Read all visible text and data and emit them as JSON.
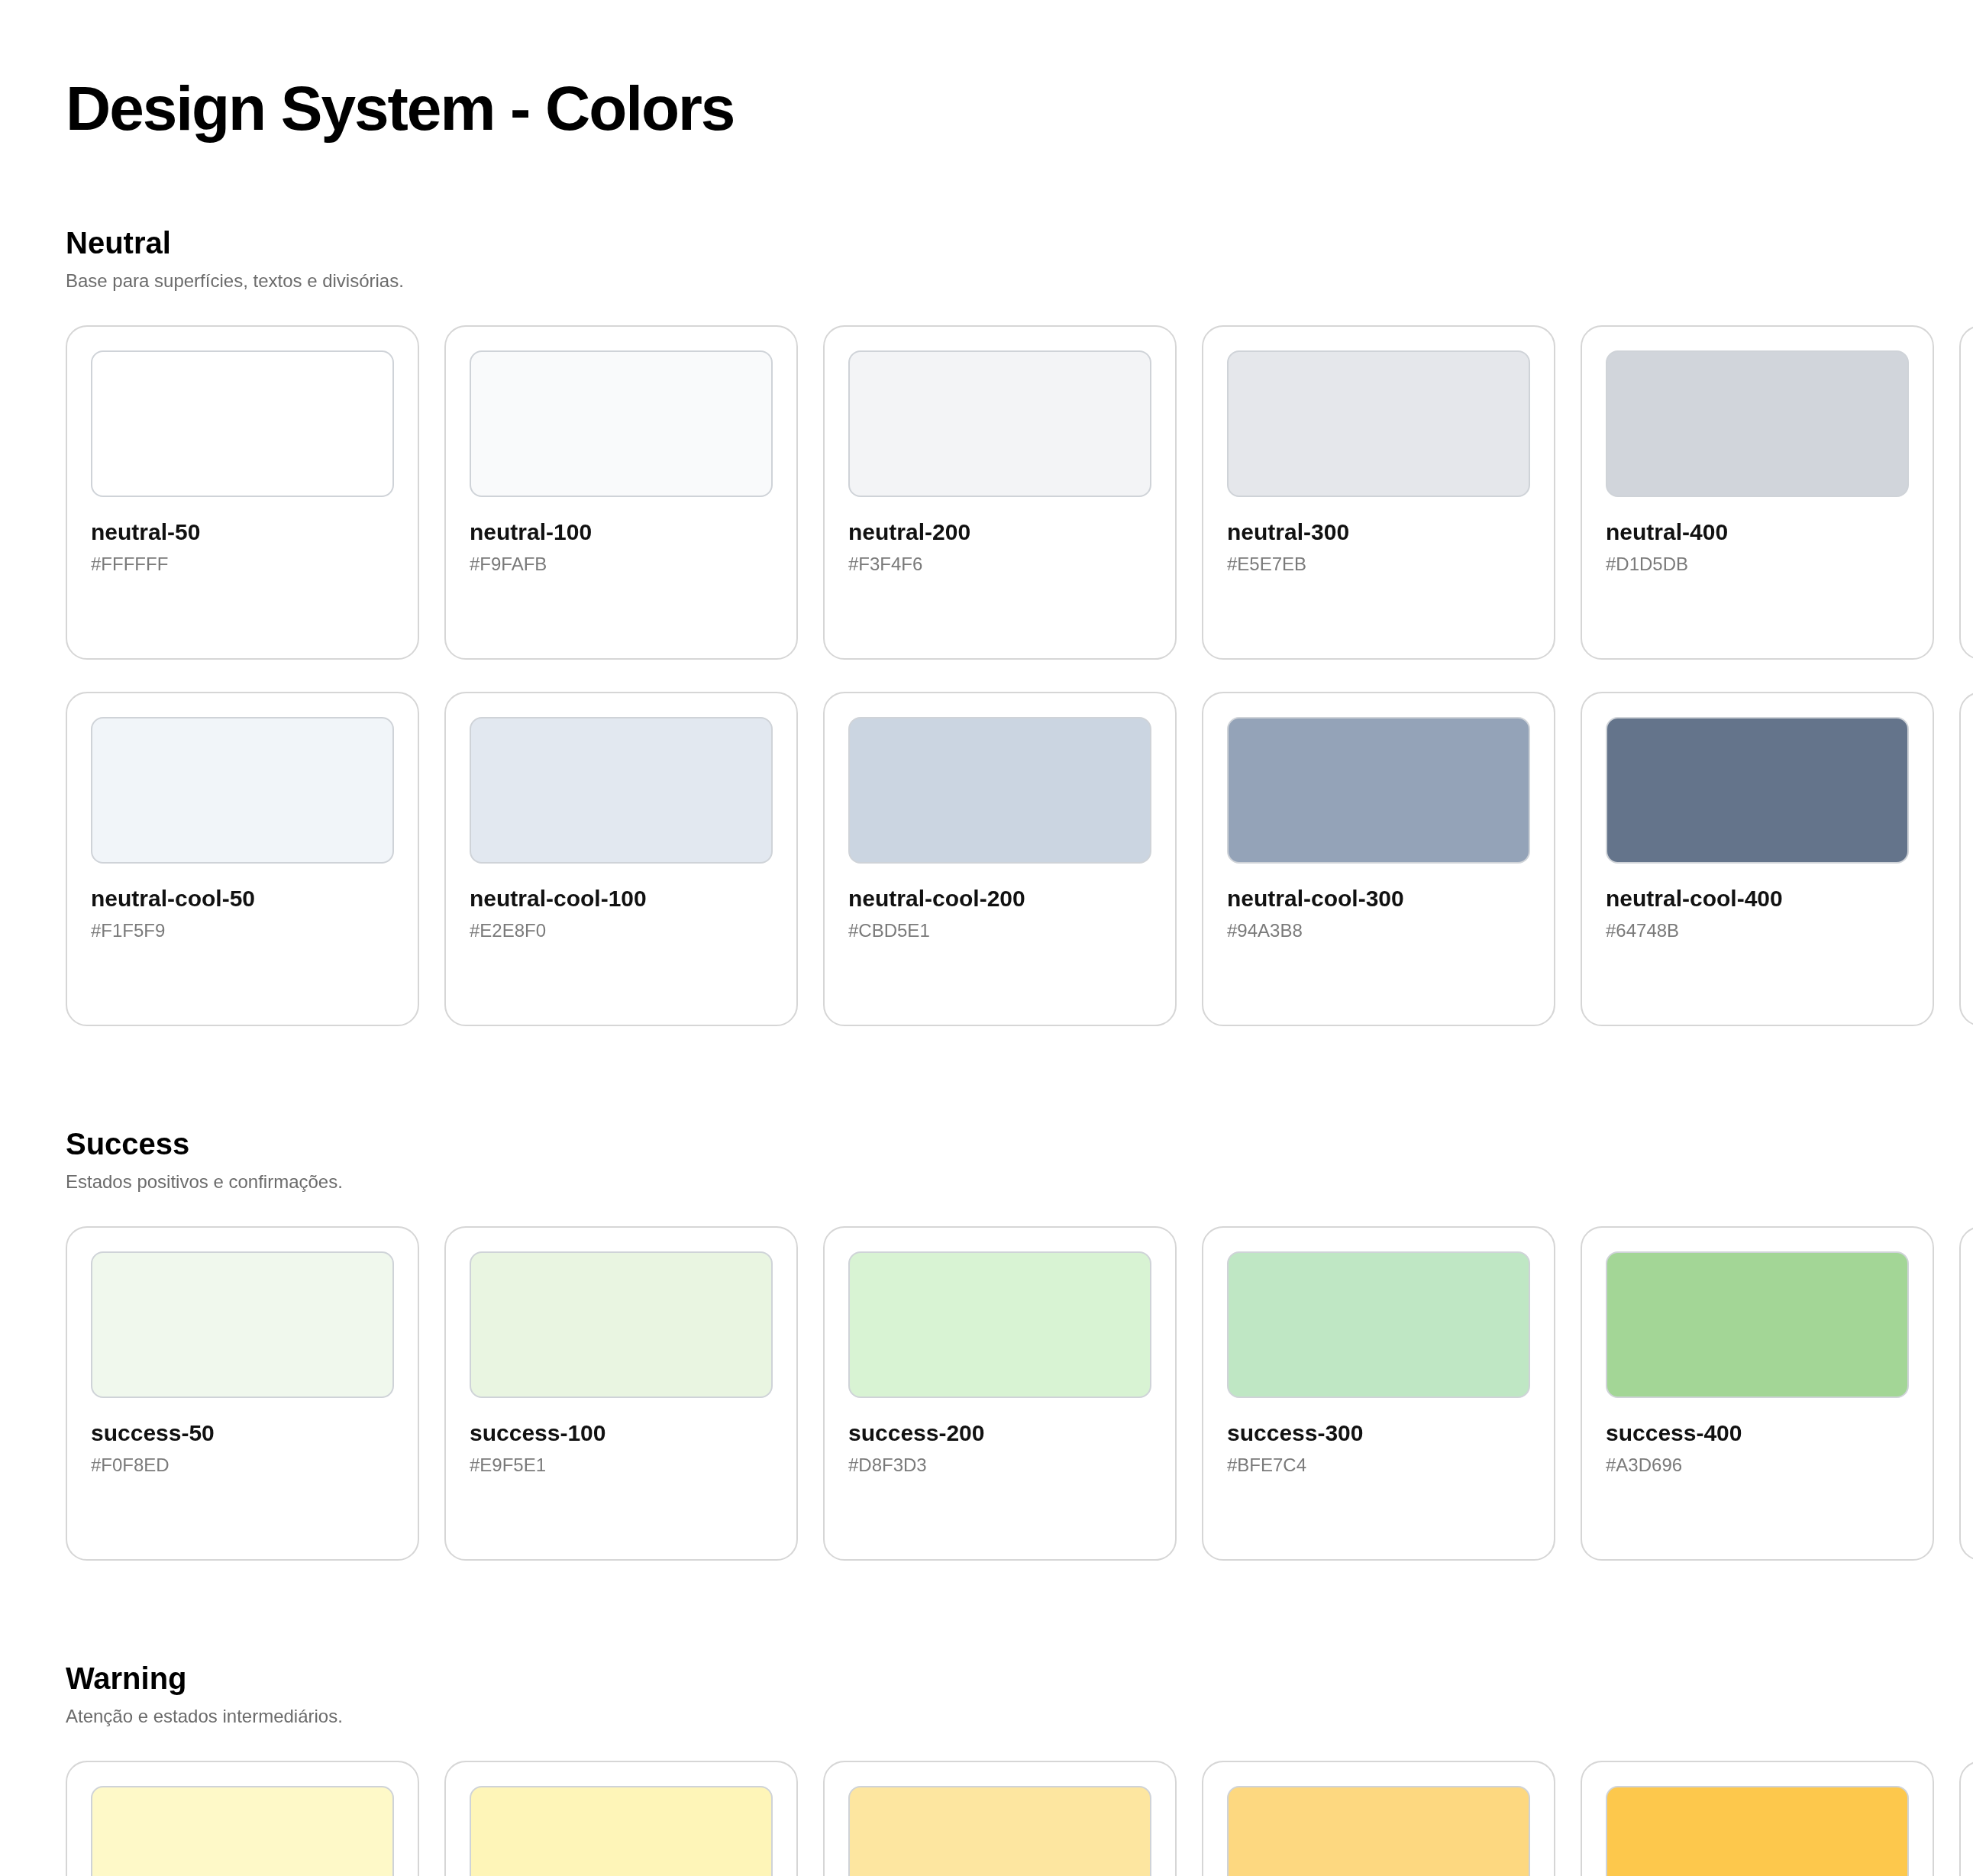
{
  "title": "Design System - Colors",
  "sections": [
    {
      "heading": "Neutral",
      "description": "Base para superfícies, textos e divisórias.",
      "rows": [
        {
          "cut_off_card": true,
          "swatches": [
            {
              "name": "neutral-50",
              "hex": "#FFFFFF",
              "color": "#ffffff"
            },
            {
              "name": "neutral-100",
              "hex": "#F9FAFB",
              "color": "#f9fafb"
            },
            {
              "name": "neutral-200",
              "hex": "#F3F4F6",
              "color": "#f3f4f6"
            },
            {
              "name": "neutral-300",
              "hex": "#E5E7EB",
              "color": "#e5e7eb"
            },
            {
              "name": "neutral-400",
              "hex": "#D1D5DB",
              "color": "#d1d5db"
            }
          ]
        },
        {
          "cut_off_card": true,
          "swatches": [
            {
              "name": "neutral-cool-50",
              "hex": "#F1F5F9",
              "color": "#f1f5f9"
            },
            {
              "name": "neutral-cool-100",
              "hex": "#E2E8F0",
              "color": "#e2e8f0"
            },
            {
              "name": "neutral-cool-200",
              "hex": "#CBD5E1",
              "color": "#cbd5e1"
            },
            {
              "name": "neutral-cool-300",
              "hex": "#94A3B8",
              "color": "#94a3b8"
            },
            {
              "name": "neutral-cool-400",
              "hex": "#64748B",
              "color": "#64748b"
            }
          ]
        }
      ]
    },
    {
      "heading": "Success",
      "description": "Estados positivos e confirmações.",
      "rows": [
        {
          "cut_off_card": true,
          "swatches": [
            {
              "name": "success-50",
              "hex": "#F0F8ED",
              "color": "#f0f8ed"
            },
            {
              "name": "success-100",
              "hex": "#E9F5E1",
              "color": "#e9f5e1"
            },
            {
              "name": "success-200",
              "hex": "#D8F3D3",
              "color": "#d8f3d3"
            },
            {
              "name": "success-300",
              "hex": "#BFE7C4",
              "color": "#bfe7c4"
            },
            {
              "name": "success-400",
              "hex": "#A3D696",
              "color": "#a3d696"
            }
          ]
        }
      ]
    },
    {
      "heading": "Warning",
      "description": "Atenção e estados intermediários.",
      "rows": [
        {
          "cut_off_card": true,
          "swatches": [
            {
              "color": "#fef9c8"
            },
            {
              "color": "#fef5b8"
            },
            {
              "color": "#fde6a0"
            },
            {
              "color": "#fdd880"
            },
            {
              "color": "#fdc84c"
            }
          ]
        }
      ]
    }
  ]
}
